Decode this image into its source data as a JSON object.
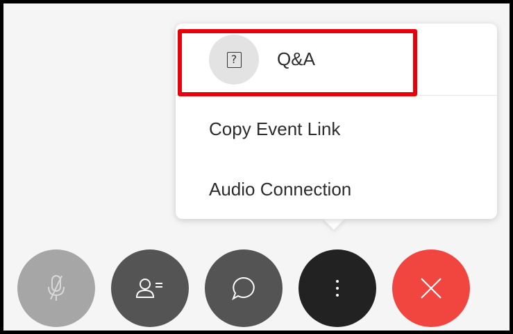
{
  "menu": {
    "items": [
      {
        "label": "Q&A",
        "icon": "question-box-icon",
        "icon_glyph": "?",
        "highlighted": true
      },
      {
        "label": "Copy Event Link"
      },
      {
        "label": "Audio Connection"
      }
    ],
    "highlight_color": "#e8000b"
  },
  "toolbar": {
    "buttons": [
      {
        "name": "mute",
        "icon": "microphone-muted-icon",
        "color": "#a6a6a6"
      },
      {
        "name": "participants",
        "icon": "participants-list-icon",
        "color": "#545454"
      },
      {
        "name": "chat",
        "icon": "chat-bubble-icon",
        "color": "#545454"
      },
      {
        "name": "more",
        "icon": "more-vertical-icon",
        "color": "#222222"
      },
      {
        "name": "leave",
        "icon": "close-icon",
        "color": "#f0463f"
      }
    ]
  }
}
